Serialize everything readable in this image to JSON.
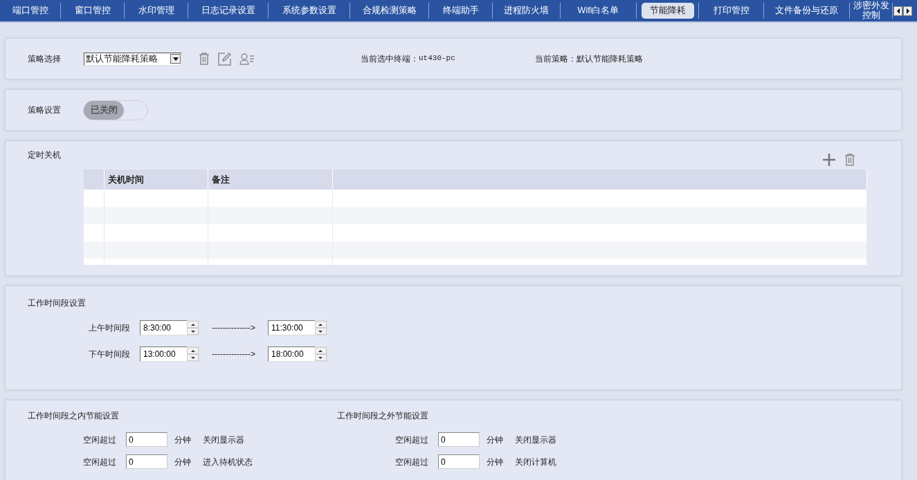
{
  "tabs": [
    {
      "label": "端口管控",
      "selected": false
    },
    {
      "label": "窗口管控",
      "selected": false
    },
    {
      "label": "水印管理",
      "selected": false
    },
    {
      "label": "日志记录设置",
      "selected": false
    },
    {
      "label": "系统参数设置",
      "selected": false
    },
    {
      "label": "合规检测策略",
      "selected": false
    },
    {
      "label": "终端助手",
      "selected": false
    },
    {
      "label": "进程防火墙",
      "selected": false
    },
    {
      "label": "Wifi白名单",
      "selected": false
    },
    {
      "label": "节能降耗",
      "selected": true
    },
    {
      "label": "打印管控",
      "selected": false
    },
    {
      "label": "文件备份与还原",
      "selected": false
    },
    {
      "label": "涉密外发控制",
      "selected": false
    }
  ],
  "policy_select": {
    "label": "策略选择",
    "value": "默认节能降耗策略",
    "terminal_label": "当前选中终端：",
    "terminal": "ut430-pc",
    "policy_label": "当前策略：",
    "policy": "默认节能降耗策略"
  },
  "policy_setting": {
    "label": "策略设置",
    "toggle_text": "已关闭",
    "on": false
  },
  "shutdown": {
    "title": "定时关机",
    "columns": [
      "关机时间",
      "备注"
    ]
  },
  "work_hours": {
    "title": "工作时间段设置",
    "periods": [
      {
        "label": "上午时间段",
        "start": "8:30:00",
        "arrow": "-------------->",
        "end": "11:30:00"
      },
      {
        "label": "下午时间段",
        "start": "13:00:00",
        "arrow": "-------------->",
        "end": "18:00:00"
      }
    ]
  },
  "energy": [
    {
      "title": "工作时间段之内节能设置",
      "rows": [
        {
          "label": "空闲超过",
          "value": "0",
          "unit": "分钟",
          "action": "关闭显示器"
        },
        {
          "label": "空闲超过",
          "value": "0",
          "unit": "分钟",
          "action": "进入待机状态"
        }
      ]
    },
    {
      "title": "工作时间段之外节能设置",
      "rows": [
        {
          "label": "空闲超过",
          "value": "0",
          "unit": "分钟",
          "action": "关闭显示器"
        },
        {
          "label": "空闲超过",
          "value": "0",
          "unit": "分钟",
          "action": "关闭计算机"
        }
      ]
    }
  ]
}
